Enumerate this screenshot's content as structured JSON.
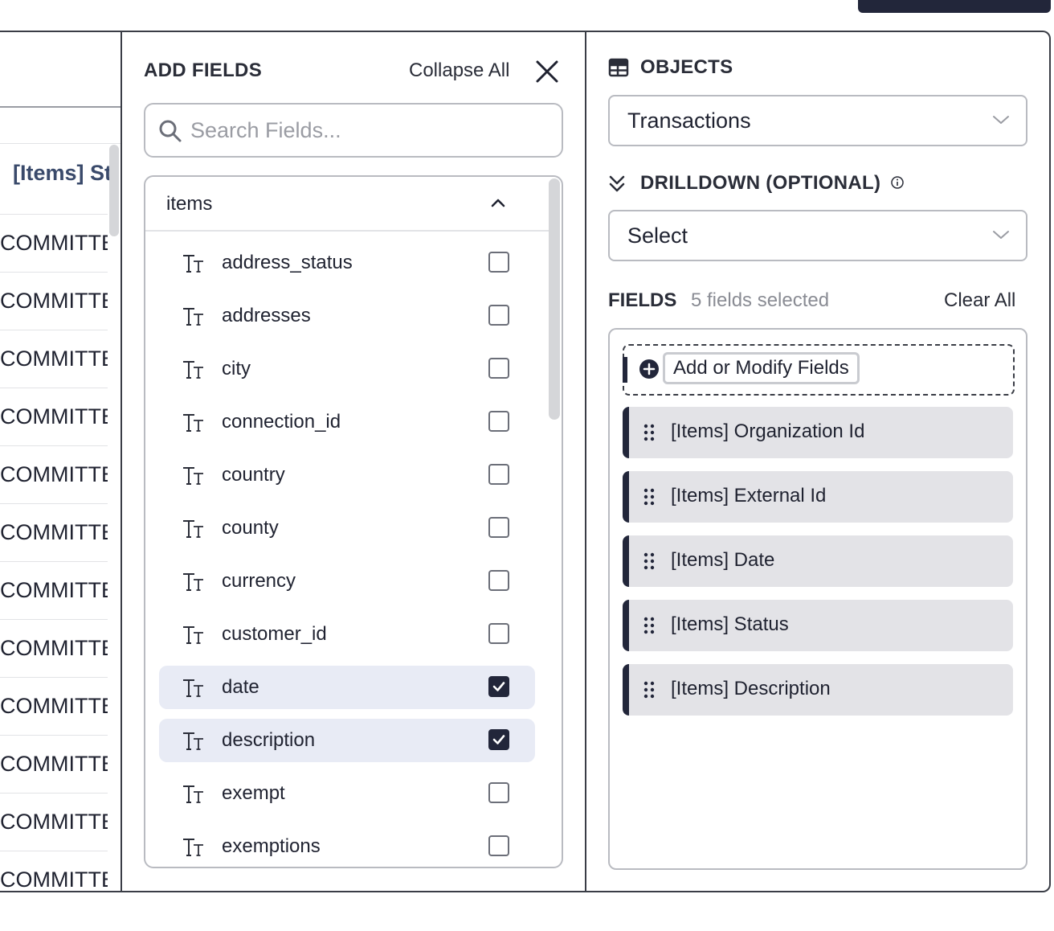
{
  "table": {
    "column_header": "[Items] St",
    "rows": [
      "COMMITTE",
      "COMMITTE",
      "COMMITTE",
      "COMMITTE",
      "COMMITTE",
      "COMMITTE",
      "COMMITTE",
      "COMMITTE",
      "COMMITTE",
      "COMMITTE",
      "COMMITTE",
      "COMMITTE"
    ]
  },
  "add_fields": {
    "title": "ADD FIELDS",
    "collapse_all": "Collapse All",
    "search_placeholder": "Search Fields...",
    "group_label": "items",
    "fields": [
      {
        "label": "address_status",
        "checked": false
      },
      {
        "label": "addresses",
        "checked": false
      },
      {
        "label": "city",
        "checked": false
      },
      {
        "label": "connection_id",
        "checked": false
      },
      {
        "label": "country",
        "checked": false
      },
      {
        "label": "county",
        "checked": false
      },
      {
        "label": "currency",
        "checked": false
      },
      {
        "label": "customer_id",
        "checked": false
      },
      {
        "label": "date",
        "checked": true
      },
      {
        "label": "description",
        "checked": true
      },
      {
        "label": "exempt",
        "checked": false
      },
      {
        "label": "exemptions",
        "checked": false
      }
    ]
  },
  "right": {
    "objects_title": "OBJECTS",
    "objects_value": "Transactions",
    "drilldown_title": "DRILLDOWN (OPTIONAL)",
    "drilldown_value": "Select",
    "fields_title": "FIELDS",
    "fields_count": "5 fields selected",
    "clear_all": "Clear All",
    "add_modify_label": "Add or Modify Fields",
    "selected_fields": [
      "[Items] Organization Id",
      "[Items] External Id",
      "[Items] Date",
      "[Items] Status",
      "[Items] Description"
    ]
  },
  "colors": {
    "accent_dark": "#22263a",
    "selected_row_bg": "#e8ebf5",
    "chip_bg": "#e3e3e7",
    "border": "#b9bbc1"
  }
}
